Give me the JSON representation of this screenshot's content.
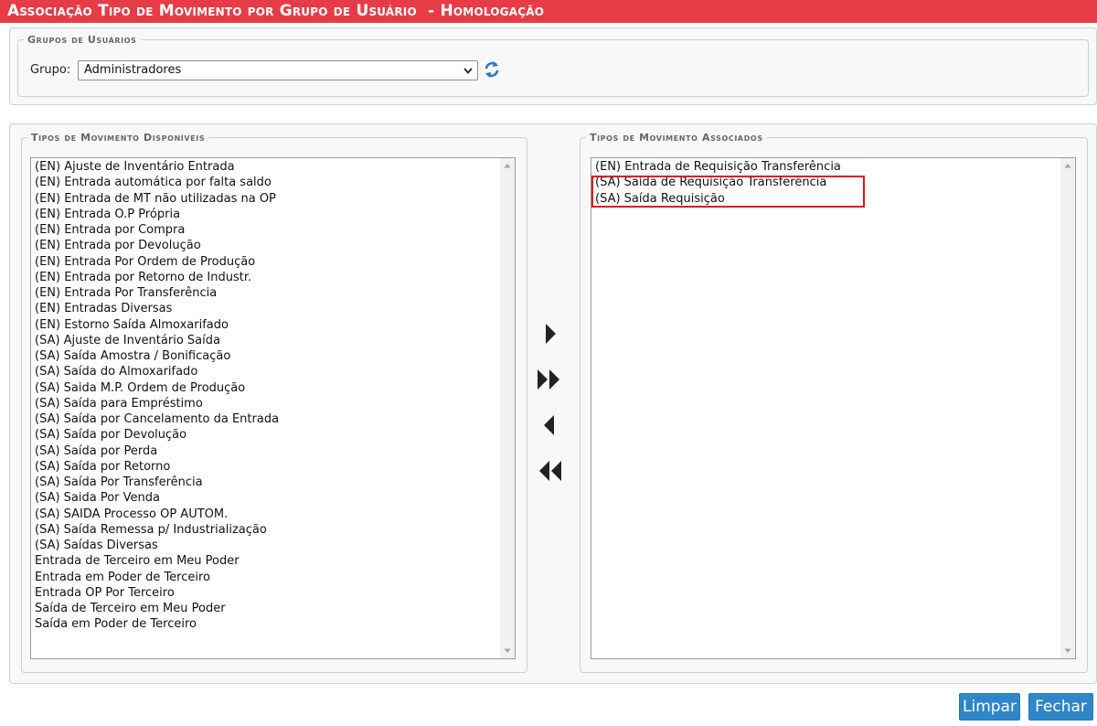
{
  "window": {
    "title": "Associação Tipo de Movimento por Grupo de Usuário  - Homologação"
  },
  "groups_panel": {
    "legend": "Grupos de Usuários",
    "grupo_label": "Grupo:",
    "grupo_selected": "Administradores",
    "refresh_icon": "refresh-icon"
  },
  "available": {
    "legend": "Tipos de Movimento Disponíveis",
    "items": [
      "(EN) Ajuste de Inventário Entrada",
      "(EN) Entrada automática por falta saldo",
      "(EN) Entrada de MT não utilizadas na OP",
      "(EN) Entrada O.P Própria",
      "(EN) Entrada por Compra",
      "(EN) Entrada por Devolução",
      "(EN) Entrada Por Ordem de Produção",
      "(EN) Entrada por Retorno de Industr.",
      "(EN) Entrada Por Transferência",
      "(EN) Entradas Diversas",
      "(EN) Estorno Saída Almoxarifado",
      "(SA) Ajuste de Inventário Saída",
      "(SA) Saída Amostra / Bonificação",
      "(SA) Saída do Almoxarifado",
      "(SA) Saida M.P. Ordem de Produção",
      "(SA) Saída para Empréstimo",
      "(SA) Saída por Cancelamento da Entrada",
      "(SA) Saída por Devolução",
      "(SA) Saída por Perda",
      "(SA) Saída por Retorno",
      "(SA) Saída Por Transferência",
      "(SA) Saida Por Venda",
      "(SA) SAIDA Processo OP AUTOM.",
      "(SA) Saída Remessa p/ Industrialização",
      "(SA) Saídas Diversas",
      "Entrada de Terceiro em Meu Poder",
      "Entrada em Poder de Terceiro",
      "Entrada OP Por Terceiro",
      "Saída de Terceiro em Meu Poder",
      "Saída em Poder de Terceiro"
    ]
  },
  "associated": {
    "legend": "Tipos de Movimento Associados",
    "items": [
      "(EN) Entrada de Requisição Transferência",
      "(SA) Saída de Requisição Transferência",
      "(SA) Saída Requisição"
    ]
  },
  "transfer_buttons": {
    "add_one_icon": "caret-right-icon",
    "add_all_icon": "double-caret-right-icon",
    "remove_one_icon": "caret-left-icon",
    "remove_all_icon": "double-caret-left-icon"
  },
  "footer": {
    "clear_label": "Limpar",
    "close_label": "Fechar"
  },
  "colors": {
    "title_bar": "#e63c47",
    "button": "#2f86c8",
    "highlight_border": "#e0101c"
  }
}
